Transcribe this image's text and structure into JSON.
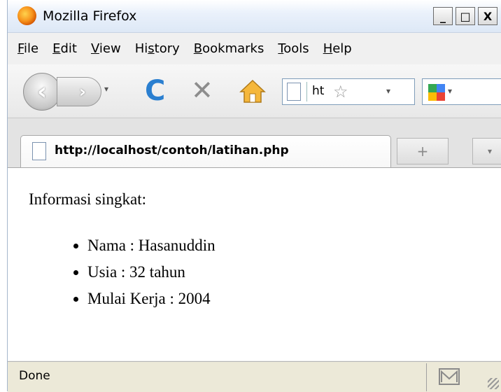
{
  "window": {
    "title": "Mozilla Firefox"
  },
  "window_buttons": {
    "minimize": "_",
    "maximize": "□",
    "close": "X"
  },
  "menubar": {
    "items": [
      {
        "pre": "",
        "key": "F",
        "post": "ile"
      },
      {
        "pre": "",
        "key": "E",
        "post": "dit"
      },
      {
        "pre": "",
        "key": "V",
        "post": "iew"
      },
      {
        "pre": "Hi",
        "key": "s",
        "post": "tory"
      },
      {
        "pre": "",
        "key": "B",
        "post": "ookmarks"
      },
      {
        "pre": "",
        "key": "T",
        "post": "ools"
      },
      {
        "pre": "",
        "key": "H",
        "post": "elp"
      }
    ]
  },
  "toolbar": {
    "back_glyph": "‹",
    "forward_glyph": "›",
    "dropdown_glyph": "▾",
    "reload_glyph": "C",
    "stop_glyph": "✕",
    "url_text": "ht",
    "star_glyph": "☆"
  },
  "tab": {
    "label": "http://localhost/contoh/latihan.php",
    "new_tab_glyph": "+",
    "list_glyph": "▾"
  },
  "content": {
    "heading": "Informasi singkat:",
    "items": [
      "Nama : Hasanuddin",
      "Usia : 32 tahun",
      "Mulai Kerja : 2004"
    ]
  },
  "status": {
    "text": "Done"
  },
  "colors": {
    "accent_blue": "#2a7fd0",
    "titlebar": "#dde8f6",
    "statusbar": "#ece9d8"
  }
}
